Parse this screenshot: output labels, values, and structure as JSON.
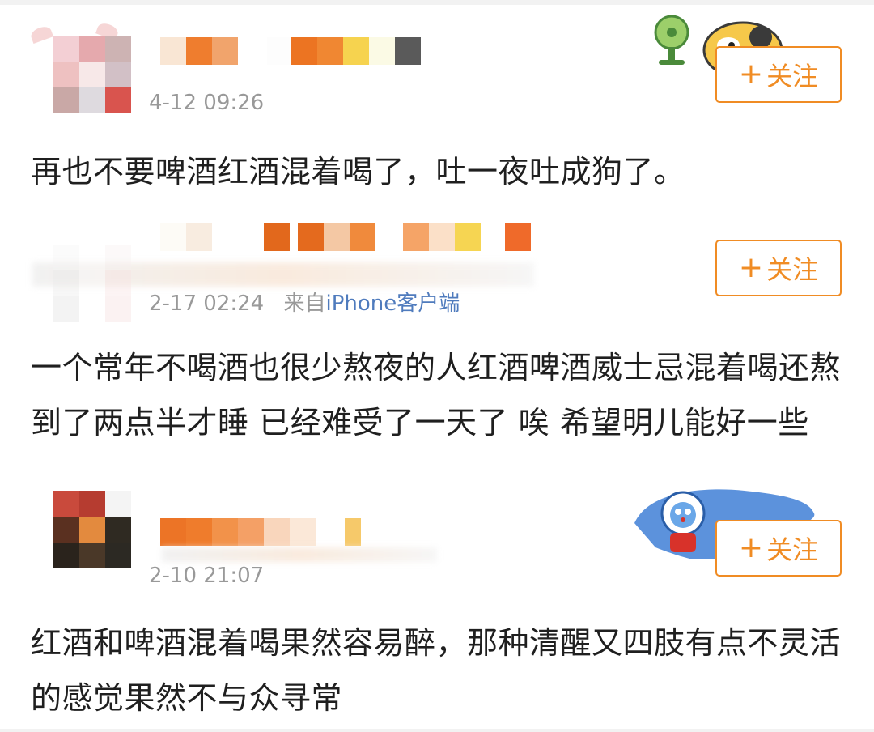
{
  "comments": [
    {
      "timestamp": "4-12 09:26",
      "source_prefix": "",
      "source_device": "",
      "follow_label": "关注",
      "text": "再也不要啤酒红酒混着喝了，吐一夜吐成狗了。"
    },
    {
      "timestamp": "2-17 02:24",
      "source_prefix": "来自",
      "source_device": "iPhone客户端",
      "follow_label": "关注",
      "text": "一个常年不喝酒也很少熬夜的人红酒啤酒威士忌混着喝还熬到了两点半才睡 已经难受了一天了 唉 希望明儿能好一些"
    },
    {
      "timestamp": "2-10 21:07",
      "source_prefix": "",
      "source_device": "",
      "follow_label": "关注",
      "text": "红酒和啤酒混着喝果然容易醉，那种清醒又四肢有点不灵活的感觉果然不与众寻常"
    }
  ],
  "icons": {
    "plus": "plus-icon"
  },
  "colors": {
    "accent": "#f08c24",
    "meta": "#999999",
    "link": "#4f7bbd",
    "text": "#1f1f1f"
  }
}
